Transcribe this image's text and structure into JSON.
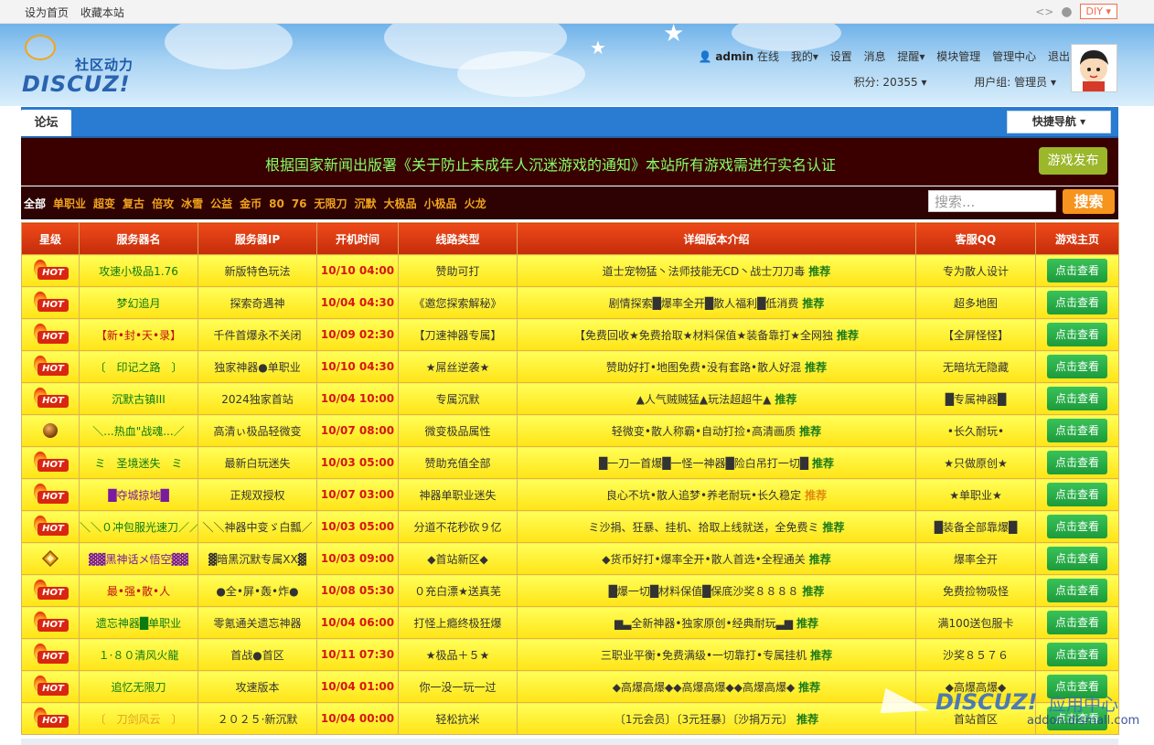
{
  "topbar": {
    "links": [
      "设为首页",
      "收藏本站"
    ],
    "diy_label": "DIY"
  },
  "logo": {
    "cn": "社区动力",
    "en": "DISCUZ!"
  },
  "user_nav": {
    "username": "admin",
    "status": "在线",
    "items": [
      "我的",
      "设置",
      "消息",
      "提醒",
      "模块管理",
      "管理中心",
      "退出"
    ],
    "points": "积分: 20355",
    "group": "用户组: 管理员"
  },
  "nav": {
    "tab": "论坛",
    "quick_nav": "快捷导航"
  },
  "banner": {
    "message": "根据国家新闻出版署《关于防止未成年人沉迷游戏的通知》本站所有游戏需进行实名认证",
    "publish_button": "游戏发布"
  },
  "filter": {
    "categories": [
      "全部",
      "单职业",
      "超变",
      "复古",
      "倍攻",
      "冰雪",
      "公益",
      "金币",
      "80",
      "76",
      "无限刀",
      "沉默",
      "大极品",
      "小极品",
      "火龙"
    ],
    "search_placeholder": "搜索...",
    "search_button": "搜索"
  },
  "table": {
    "headers": [
      "星级",
      "服务器名",
      "服务器IP",
      "开机时间",
      "线路类型",
      "详细版本介绍",
      "客服QQ",
      "游戏主页"
    ],
    "rec_label": "推荐",
    "view_label": "点击查看",
    "hot_label": "HOT",
    "rows": [
      {
        "icon": "hot",
        "name": "攻速小极品1.76",
        "ip": "新版特色玩法",
        "time": "10/10 04:00",
        "line": "赞助可打",
        "desc": "道士宠物猛丶法师技能无CD丶战士刀刀毒",
        "qq": "专为散人设计",
        "name_color": "#0b7b11"
      },
      {
        "icon": "hot",
        "name": "梦幻追月",
        "ip": "探索奇遇神",
        "time": "10/04 04:30",
        "line": "《邀您探索解秘》",
        "desc": "剧情探索█爆率全开█散人福利█低消费",
        "qq": "超多地图",
        "name_color": "#0b7b11"
      },
      {
        "icon": "hot",
        "name": "【新•封•天•录】",
        "ip": "千件首爆永不关闭",
        "time": "10/09 02:30",
        "line": "【刀速神器专属】",
        "desc": "【免费回收★免费拾取★材料保值★装备靠打★全网独",
        "qq": "【全屏怪怪】",
        "name_color": "#c01010"
      },
      {
        "icon": "hot",
        "name": "〔　印记之路　〕",
        "ip": "独家神器●单职业",
        "time": "10/10 04:30",
        "line": "★屌丝逆袭★",
        "desc": "赞助好打•地图免费•没有套路•散人好混",
        "qq": "无暗坑无隐藏",
        "name_color": "#0b7b11"
      },
      {
        "icon": "hot",
        "name": "沉默古镇III",
        "ip": "2024独家首站",
        "time": "10/04 10:00",
        "line": "专属沉默",
        "desc": "▲人气贼贼猛▲玩法超超牛▲",
        "qq": "█专属神器█",
        "name_color": "#0b7b11"
      },
      {
        "icon": "ball",
        "name": "＼...热血\"战魂...／",
        "ip": "高清ぃ极品轻微变",
        "time": "10/07 08:00",
        "line": "微变极品属性",
        "desc": "轻微变•散人称霸•自动打捡•高清画质",
        "qq": "•长久耐玩•",
        "name_color": "#0b7b11"
      },
      {
        "icon": "hot",
        "name": "ミ　圣境迷失　ミ",
        "ip": "最新白玩迷失",
        "time": "10/03 05:00",
        "line": "赞助充值全部",
        "desc": "█一刀一首爆█一怪一神器█险白吊打一切█",
        "qq": "★只做原创★",
        "name_color": "#0b7b11"
      },
      {
        "icon": "hot",
        "name": "█夺城掠地█",
        "ip": "正规双授权",
        "time": "10/07 03:00",
        "line": "神器单职业迷失",
        "desc": "良心不坑•散人追梦•养老耐玩•长久稳定",
        "qq": "★单职业★",
        "name_color": "#7a1aa0",
        "rec_orange": true
      },
      {
        "icon": "hot",
        "name": "＼＼０冲包服光速刀／／",
        "ip": "＼＼神器中变ゞ白瓢／",
        "time": "10/03 05:00",
        "line": "分道不花秒砍９亿",
        "desc": "ミ沙捐、狂暴、挂机、拾取上线就送，全免费ミ",
        "qq": "█装备全部靠爆█",
        "name_color": "#0b7b11"
      },
      {
        "icon": "diamond",
        "name": "▓▓黑神话メ悟空▓▓",
        "ip": "▓暗黑沉默专属XX▓",
        "time": "10/03 09:00",
        "line": "◆首站新区◆",
        "desc": "◆货币好打•爆率全开•散人首选•全程通关",
        "qq": "爆率全开",
        "name_color": "#7a1aa0"
      },
      {
        "icon": "hot",
        "name": "最•强•散•人",
        "ip": "●全•屏•轰•炸●",
        "time": "10/08 05:30",
        "line": "０充白漂★送真芜",
        "desc": "█爆一切█材料保值█保底沙奖８８８８",
        "qq": "免费捡物吸怪",
        "name_color": "#c01010"
      },
      {
        "icon": "hot",
        "name": "遗忘神器█单职业",
        "ip": "零氪通关遗忘神器",
        "time": "10/04 06:00",
        "line": "打怪上瘾终极狂爆",
        "desc": "▆▃全新神器•独家原创•经典耐玩▃▆",
        "qq": "满100送包服卡",
        "name_color": "#0b7b11"
      },
      {
        "icon": "hot",
        "name": "１·８０清风火龍",
        "ip": "首战●首区",
        "time": "10/11 07:30",
        "line": "★极品＋５★",
        "desc": "三职业平衡•免费满级•一切靠打•专属挂机",
        "qq": "沙奖８５７６",
        "name_color": "#0b7b11"
      },
      {
        "icon": "hot",
        "name": "追忆无限刀",
        "ip": "攻速版本",
        "time": "10/04 01:00",
        "line": "你一没一玩一过",
        "desc": "◆高爆高爆◆◆高爆高爆◆◆高爆高爆◆",
        "qq": "◆高爆高爆◆",
        "name_color": "#0b7b11"
      },
      {
        "icon": "hot",
        "name": "〔　刀剑风云　〕",
        "ip": "２０２５·新沉默",
        "time": "10/04 00:00",
        "line": "轻松抗米",
        "desc": "〔1元会员〕〔3元狂暴〕〔沙捐万元〕",
        "qq": "首站首区",
        "name_color": "#e0a020"
      }
    ]
  },
  "watermark": {
    "brand": "DISCUZ!",
    "cn": "应用中心",
    "url": "addon.dismall.com"
  }
}
